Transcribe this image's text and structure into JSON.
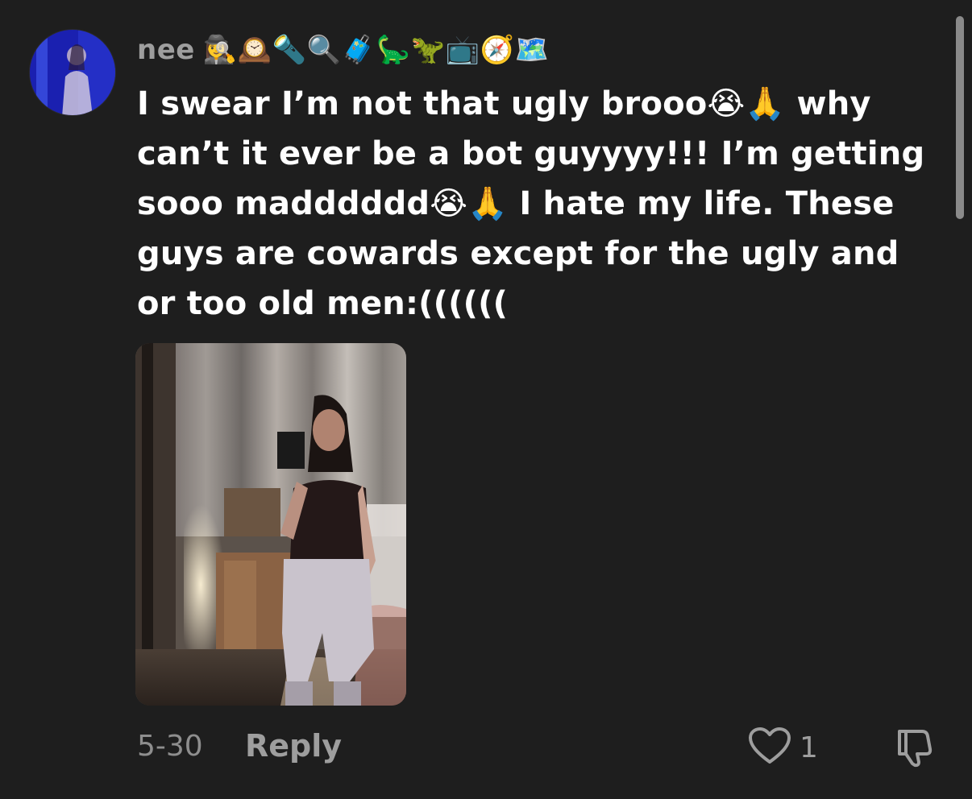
{
  "comment": {
    "username": "nee",
    "badges": [
      {
        "name": "detective-icon",
        "glyph": "🕵️‍♀️"
      },
      {
        "name": "mantelpiece-clock-icon",
        "glyph": "🕰️"
      },
      {
        "name": "flashlight-icon",
        "glyph": "🔦"
      },
      {
        "name": "magnifying-glass-icon",
        "glyph": "🔍"
      },
      {
        "name": "suitcase-icon",
        "glyph": "🧳"
      },
      {
        "name": "sauropod-icon",
        "glyph": "🦕"
      },
      {
        "name": "t-rex-icon",
        "glyph": "🦖"
      },
      {
        "name": "television-icon",
        "glyph": "📺"
      },
      {
        "name": "compass-icon",
        "glyph": "🧭"
      },
      {
        "name": "world-map-icon",
        "glyph": "🗺️"
      }
    ],
    "text": "I swear I’m not that ugly brooo😭🙏 why can’t it ever be a bot guyyyy!!! I’m getting sooo madddddd😭🙏 I hate my life. These guys are cowards except for the ugly and or too old men:((((((",
    "date": "5-30",
    "reply_label": "Reply",
    "like_count": "1"
  },
  "colors": {
    "background": "#1e1e1e",
    "text": "#ffffff",
    "muted": "#9e9e9e",
    "scrollbar": "#8a8a8a"
  }
}
